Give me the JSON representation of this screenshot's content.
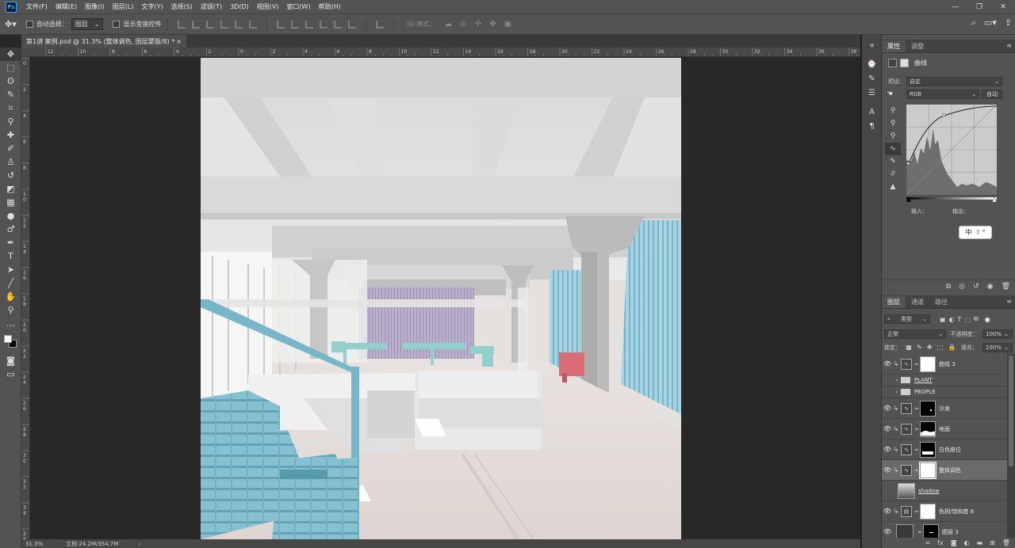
{
  "app": {
    "logo": "Ps"
  },
  "menu": [
    "文件(F)",
    "编辑(E)",
    "图像(I)",
    "图层(L)",
    "文字(Y)",
    "选择(S)",
    "滤镜(T)",
    "3D(D)",
    "视图(V)",
    "窗口(W)",
    "帮助(H)"
  ],
  "window_controls": {
    "minimize": "—",
    "restore": "❐",
    "close": "✕"
  },
  "options": {
    "auto_select_label": "自动选择：",
    "auto_select_value": "图层",
    "show_transform_label": "显示变换控件",
    "mode_3d_label": "3D 模式："
  },
  "doc_tab": {
    "title": "第1讲 案例.psd @ 31.3% (整体调色, 图层蒙版/8) *",
    "close": "×"
  },
  "ruler_top": [
    "12",
    "10",
    "8",
    "6",
    "4",
    "2",
    "0",
    "2",
    "4",
    "6",
    "8",
    "10",
    "12",
    "14",
    "16",
    "18",
    "20",
    "22",
    "24",
    "26",
    "28",
    "30",
    "32",
    "34",
    "36",
    "38"
  ],
  "ruler_left": [
    "0",
    "2",
    "4",
    "6",
    "8",
    "1\n0",
    "1\n2",
    "1\n4",
    "1\n6",
    "1\n8",
    "2\n0",
    "2\n2",
    "2\n4",
    "2\n6",
    "2\n8",
    "3\n0",
    "3\n2",
    "3\n4",
    "3\n6"
  ],
  "status": {
    "zoom": "31.3%",
    "doc": "文档:24.2M/354.7M",
    "arrow": "›"
  },
  "properties": {
    "tabs": [
      "属性",
      "调整"
    ],
    "title": "曲线",
    "preset_label": "预设：",
    "preset_value": "自定",
    "channel_value": "RGB",
    "auto_button": "自动",
    "input_label": "输入：",
    "output_label": "输出：",
    "ime_text": "中"
  },
  "layers": {
    "tabs": [
      "图层",
      "通道",
      "路径"
    ],
    "filter_value": "类型",
    "blend_mode": "正常",
    "opacity_label": "不透明度：",
    "opacity_value": "100%",
    "lock_label": "锁定：",
    "fill_label": "填充：",
    "fill_value": "100%",
    "items": [
      {
        "name": "曲线 3",
        "visible": true,
        "kind": "adjustment",
        "mask": "white"
      },
      {
        "name": "PLANT",
        "visible": false,
        "kind": "group"
      },
      {
        "name": "PEOPLE",
        "visible": false,
        "kind": "group"
      },
      {
        "name": "沙发",
        "visible": true,
        "kind": "adjustment",
        "mask": "black"
      },
      {
        "name": "地面",
        "visible": true,
        "kind": "adjustment",
        "mask": "black"
      },
      {
        "name": "白色座位",
        "visible": true,
        "kind": "adjustment",
        "mask": "black"
      },
      {
        "name": "整体调色",
        "visible": true,
        "kind": "adjustment",
        "mask": "white",
        "selected": true
      },
      {
        "name": "shadow",
        "visible": false,
        "kind": "image"
      },
      {
        "name": "色相/饱和度 6",
        "visible": true,
        "kind": "adjustment",
        "mask": "white"
      },
      {
        "name": "图层 3",
        "visible": true,
        "kind": "layer",
        "mask": "black"
      }
    ]
  },
  "colors": {
    "chrome": "#535353",
    "canvas_bg": "#282828",
    "accent_blue": "#31a8ff",
    "wall_blue": "#86c6d8",
    "lavender": "#a89cbd",
    "sofa_red": "#d7656f"
  }
}
